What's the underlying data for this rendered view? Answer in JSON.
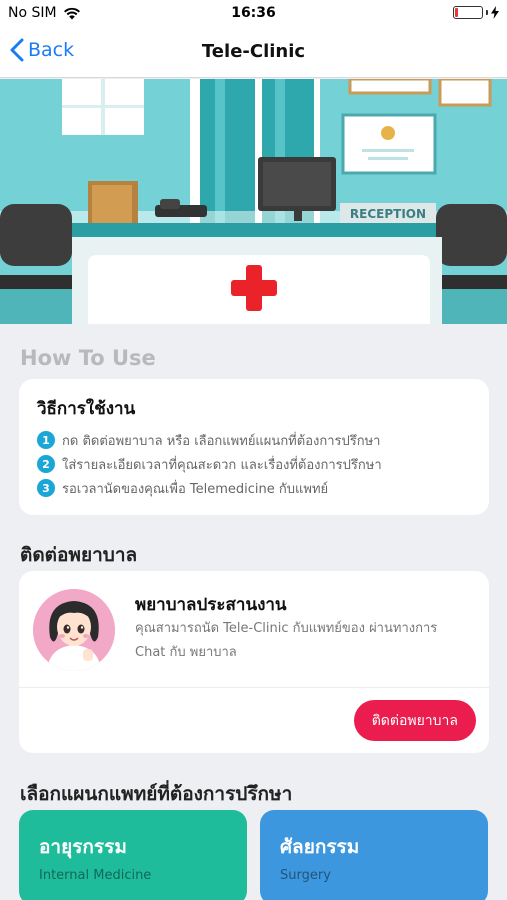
{
  "status_bar": {
    "carrier": "No SIM",
    "time": "16:36",
    "battery_level": 0.12
  },
  "nav": {
    "back_label": "Back",
    "title": "Tele-Clinic"
  },
  "hero": {
    "reception_sign": "RECEPTION"
  },
  "how_to_use": {
    "heading": "How To Use",
    "card_title": "วิธีการใช้งาน",
    "steps": [
      {
        "num": "1",
        "text": "กด ติดต่อพยาบาล หรือ เลือกแพทย์แผนกที่ต้องการปรึกษา"
      },
      {
        "num": "2",
        "text": "ใส่รายละเอียดเวลาที่คุณสะดวก และเรื่องที่ต้องการปรึกษา"
      },
      {
        "num": "3",
        "text": "รอเวลานัดของคุณเพื่อ Telemedicine กับแพทย์"
      }
    ]
  },
  "contact_nurse": {
    "heading": "ติดต่อพยาบาล",
    "name": "พยาบาลประสานงาน",
    "description": "คุณสามารถนัด Tele-Clinic กับแพทย์ของ ผ่านทางการ Chat กับ พยาบาล",
    "button_label": "ติดต่อพยาบาล"
  },
  "departments": {
    "heading": "เลือกแผนกแพทย์ที่ต้องการปรึกษา",
    "items": [
      {
        "th": "อายุรกรรม",
        "en": "Internal Medicine",
        "color": "#1fbc9b"
      },
      {
        "th": "ศัลยกรรม",
        "en": "Surgery",
        "color": "#3d97de"
      }
    ]
  },
  "colors": {
    "accent": "#1a7cf5",
    "cta": "#ea1d4e",
    "step_badge": "#1ba6d6"
  }
}
